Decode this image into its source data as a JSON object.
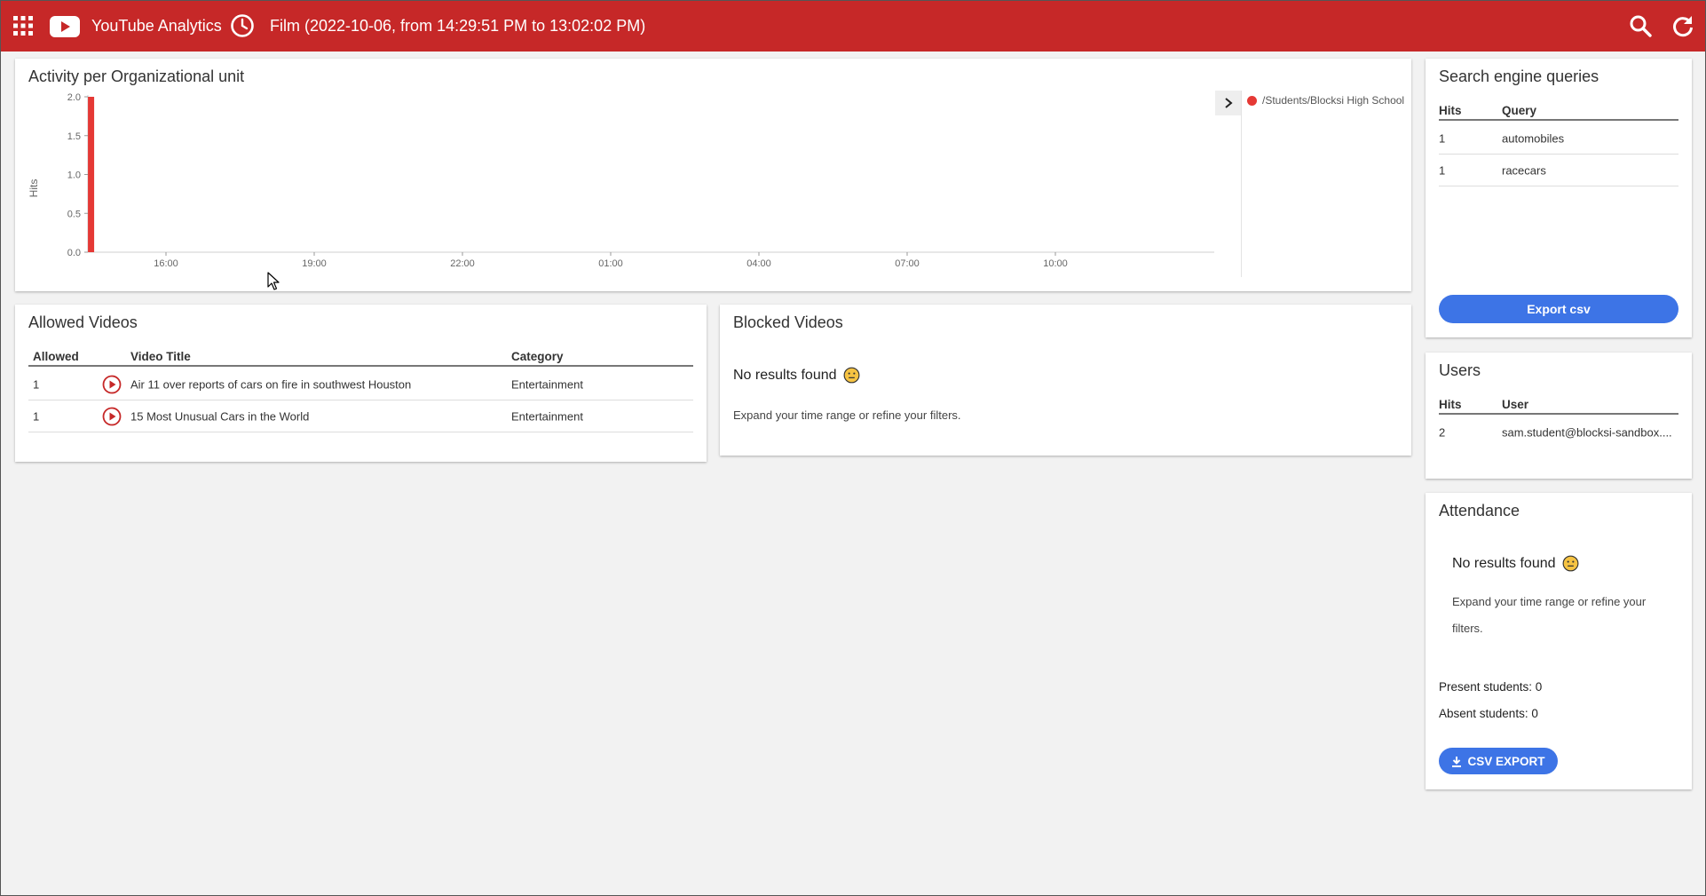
{
  "header": {
    "app_title": "YouTube Analytics",
    "time_range": "Film (2022-10-06, from 14:29:51 PM to 13:02:02 PM)",
    "icons": [
      "apps-grid-icon",
      "youtube-logo-icon",
      "clock-icon",
      "search-icon",
      "refresh-icon"
    ],
    "bar_color": "#c62828"
  },
  "activity": {
    "title": "Activity per Organizational unit",
    "legend": [
      "/Students/Blocksi High School"
    ],
    "chart_data": {
      "type": "bar",
      "title": "Activity per Organizational unit",
      "ylabel": "Hits",
      "xlabel": "",
      "ylim": [
        0,
        2.0
      ],
      "y_ticks": [
        "0.0",
        "0.5",
        "1.0",
        "1.5",
        "2.0"
      ],
      "x_ticks": [
        "16:00",
        "19:00",
        "22:00",
        "01:00",
        "04:00",
        "07:00",
        "10:00"
      ],
      "series": [
        {
          "name": "/Students/Blocksi High School",
          "color": "#e53935",
          "points": [
            {
              "x": "14:29",
              "y": 2
            }
          ]
        }
      ],
      "grid": false,
      "legend_position": "right"
    }
  },
  "allowed": {
    "title": "Allowed Videos",
    "columns": [
      "Allowed",
      "Video Title",
      "Category"
    ],
    "rows": [
      {
        "allowed": "1",
        "title": "Air 11 over reports of cars on fire in southwest Houston",
        "category": "Entertainment"
      },
      {
        "allowed": "1",
        "title": "15 Most Unusual Cars in the World",
        "category": "Entertainment"
      }
    ]
  },
  "blocked": {
    "title": "Blocked Videos",
    "no_results": "No results found",
    "hint": "Expand your time range or refine your filters."
  },
  "search_queries": {
    "title": "Search engine queries",
    "columns": [
      "Hits",
      "Query"
    ],
    "rows": [
      {
        "hits": "1",
        "query": "automobiles"
      },
      {
        "hits": "1",
        "query": "racecars"
      }
    ],
    "export_label": "Export csv"
  },
  "users": {
    "title": "Users",
    "columns": [
      "Hits",
      "User"
    ],
    "rows": [
      {
        "hits": "2",
        "user": "sam.student@blocksi-sandbox...."
      }
    ]
  },
  "attendance": {
    "title": "Attendance",
    "no_results": "No results found",
    "hint_line1": "Expand your time range or refine your",
    "hint_line2": "filters.",
    "present": "Present students: 0",
    "absent": "Absent students: 0",
    "export_label": "CSV EXPORT"
  },
  "colors": {
    "accent": "#3d74e6",
    "bar": "#e53935",
    "header": "#c62828"
  }
}
